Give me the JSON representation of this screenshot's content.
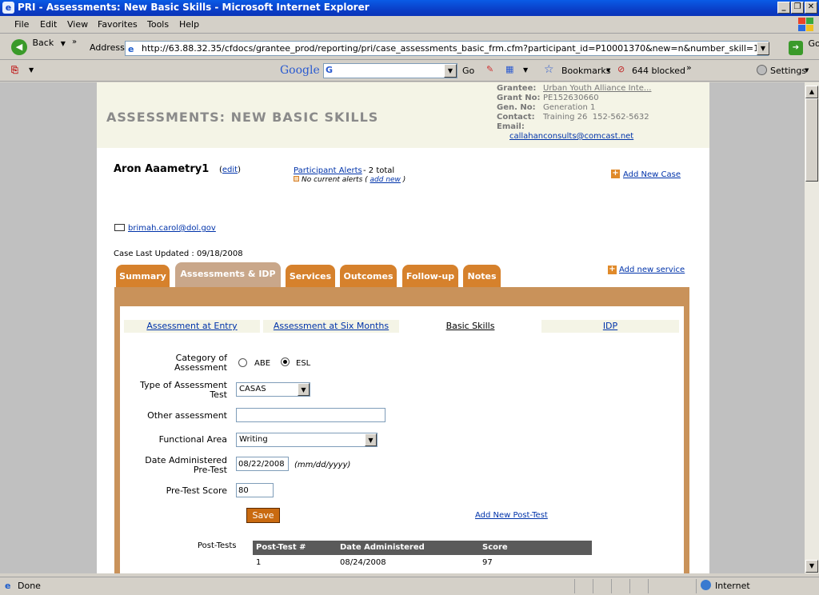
{
  "window": {
    "title": "PRI - Assessments: New Basic Skills - Microsoft Internet Explorer"
  },
  "menu": [
    "File",
    "Edit",
    "View",
    "Favorites",
    "Tools",
    "Help"
  ],
  "toolbar": {
    "back": "Back",
    "address_label": "Address",
    "url": "http://63.88.32.35/cfdocs/grantee_prod/reporting/pri/case_assessments_basic_frm.cfm?participant_id=P10001370&new=n&number_skill=1",
    "go": "Go"
  },
  "toolbar2": {
    "google": "Google",
    "go": "Go",
    "bookmarks": "Bookmarks",
    "blocked": "644 blocked",
    "settings": "Settings"
  },
  "header": {
    "page_title": "ASSESSMENTS: NEW BASIC SKILLS",
    "grantee_label": "Grantee:",
    "grantee_value": "Urban Youth Alliance Inte...",
    "grant_no_label": "Grant No:",
    "grant_no_value": "PE152630660",
    "gen_no_label": "Gen. No:",
    "gen_no_value": "Generation 1",
    "contact_label": "Contact:",
    "contact_value": "Training 26  152-562-5632",
    "email_label": "Email:",
    "email_value": "callahanconsults@comcast.net"
  },
  "participant": {
    "name": "Aron Aaametry1",
    "edit_open": "(",
    "edit": "edit",
    "edit_close": ")",
    "email": "brimah.carol@dol.gov",
    "last_updated": "Case Last Updated : 09/18/2008"
  },
  "alerts": {
    "link": "Participant Alerts",
    "total": " - 2 total",
    "none": "No current alerts (",
    "add_new": "add new",
    "close": ")"
  },
  "actions": {
    "add_new_case": "Add New Case",
    "add_new_service": "Add new service"
  },
  "tabs": [
    "Summary",
    "Assessments & IDP",
    "Services",
    "Outcomes",
    "Follow-up",
    "Notes"
  ],
  "subtabs": [
    "Assessment at Entry",
    "Assessment at Six Months",
    "Basic Skills",
    "IDP"
  ],
  "form": {
    "category_label": "Category of Assessment",
    "radio_abe": "ABE",
    "radio_esl": "ESL",
    "selected_category": "ESL",
    "test_type_label": "Type of Assessment Test",
    "test_type_value": "CASAS",
    "other_label": "Other assessment",
    "other_value": "",
    "functional_label": "Functional Area",
    "functional_value": "Writing",
    "date_label": "Date Administered Pre-Test",
    "date_value": "08/22/2008",
    "date_hint": "(mm/dd/yyyy)",
    "score_label": "Pre-Test Score",
    "score_value": "80",
    "save": "Save",
    "add_post_test": "Add New Post-Test"
  },
  "post_tests": {
    "label": "Post-Tests",
    "columns": [
      "Post-Test #",
      "Date Administered",
      "Score"
    ],
    "rows": [
      [
        "1",
        "08/24/2008",
        "97"
      ]
    ]
  },
  "status": {
    "left": "Done",
    "zone": "Internet"
  }
}
